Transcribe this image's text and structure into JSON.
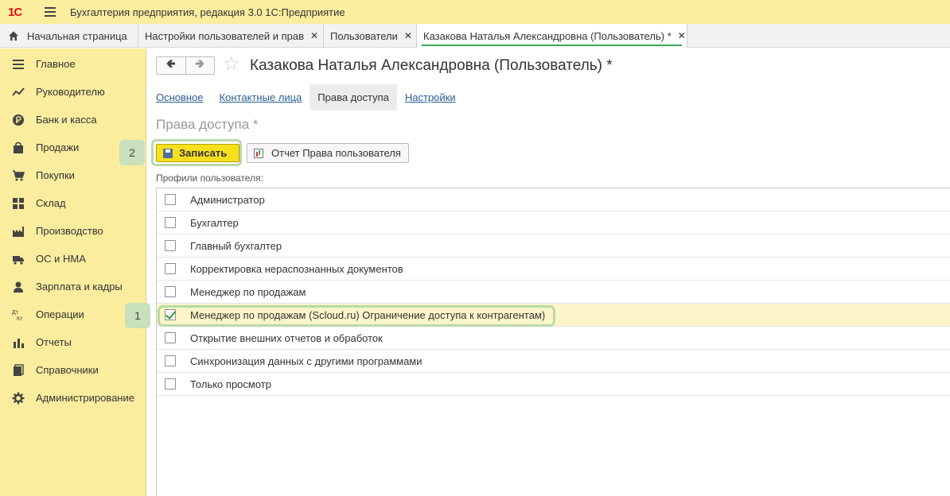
{
  "titlebar": {
    "logo": "1С",
    "title": "Бухгалтерия предприятия, редакция 3.0 1С:Предприятие"
  },
  "tabs": [
    {
      "label": "Начальная страница",
      "icon": "home-icon"
    },
    {
      "label": "Настройки пользователей и прав",
      "close": "✕"
    },
    {
      "label": "Пользователи",
      "close": "✕"
    },
    {
      "label": "Казакова Наталья Александровна (Пользователь) *",
      "close": "✕",
      "active": true
    }
  ],
  "sidebar": {
    "items": [
      {
        "label": "Главное",
        "icon": "menu-lines-icon"
      },
      {
        "label": "Руководителю",
        "icon": "trend-icon"
      },
      {
        "label": "Банк и касса",
        "icon": "ruble-coin-icon"
      },
      {
        "label": "Продажи",
        "icon": "shopping-bag-icon"
      },
      {
        "label": "Покупки",
        "icon": "cart-icon"
      },
      {
        "label": "Склад",
        "icon": "warehouse-icon"
      },
      {
        "label": "Производство",
        "icon": "factory-icon"
      },
      {
        "label": "ОС и НМА",
        "icon": "truck-icon"
      },
      {
        "label": "Зарплата и кадры",
        "icon": "person-icon"
      },
      {
        "label": "Операции",
        "icon": "debit-credit-icon"
      },
      {
        "label": "Отчеты",
        "icon": "bar-chart-icon"
      },
      {
        "label": "Справочники",
        "icon": "books-icon"
      },
      {
        "label": "Администрирование",
        "icon": "gear-icon"
      }
    ]
  },
  "form": {
    "title": "Казакова Наталья Александровна (Пользователь) *",
    "subnav": [
      {
        "label": "Основное",
        "active": false
      },
      {
        "label": "Контактные лица",
        "active": false
      },
      {
        "label": "Права доступа",
        "active": true
      },
      {
        "label": "Настройки",
        "active": false
      }
    ],
    "section_title": "Права доступа *",
    "save_label": "Записать",
    "report_label": "Отчет Права пользователя",
    "profiles_label": "Профили пользователя:",
    "badges": {
      "row": "1",
      "save": "2"
    },
    "profiles": [
      {
        "label": "Администратор",
        "checked": false
      },
      {
        "label": "Бухгалтер",
        "checked": false
      },
      {
        "label": "Главный бухгалтер",
        "checked": false
      },
      {
        "label": "Корректировка нераспознанных документов",
        "checked": false
      },
      {
        "label": "Менеджер по продажам",
        "checked": false
      },
      {
        "label": "Менеджер по продажам (Scloud.ru) Ограничение доступа к контрагентам)",
        "checked": true
      },
      {
        "label": "Открытие внешних отчетов и обработок",
        "checked": false
      },
      {
        "label": "Синхронизация данных с другими программами",
        "checked": false
      },
      {
        "label": "Только просмотр",
        "checked": false
      }
    ]
  },
  "colors": {
    "sidebar_bg": "#fbed9e",
    "save_button": "#f9e01c",
    "active_tab_underline": "#3aa656",
    "highlight": "#b9d9a8",
    "link": "#2a5d96"
  }
}
